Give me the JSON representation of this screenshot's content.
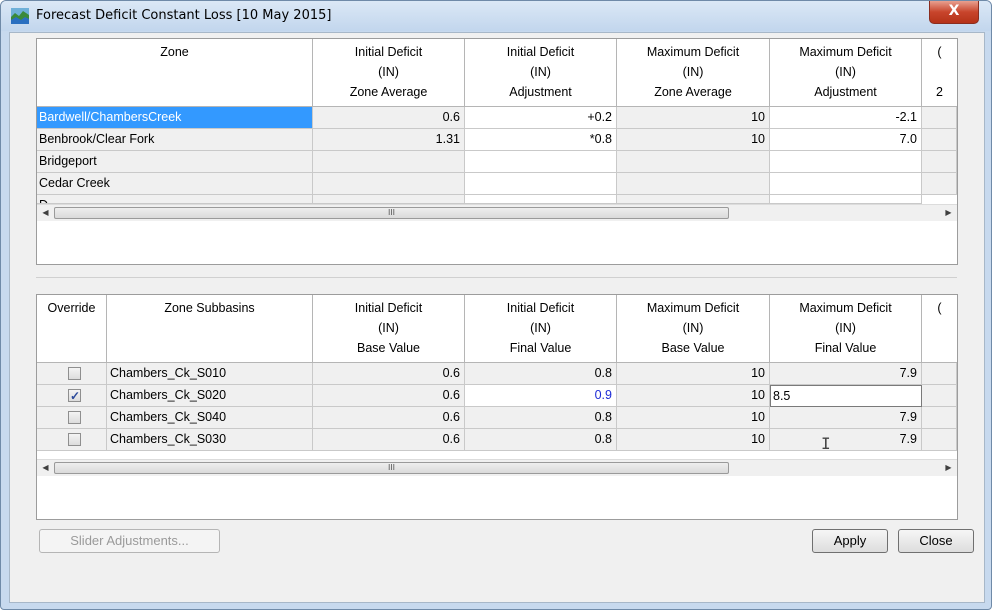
{
  "window": {
    "title": "Forecast Deficit Constant Loss [10 May 2015]",
    "close_label": "X"
  },
  "zone_table": {
    "headers": [
      {
        "lines": [
          "Zone",
          "",
          ""
        ]
      },
      {
        "lines": [
          "Initial Deficit",
          "(IN)",
          "Zone Average"
        ]
      },
      {
        "lines": [
          "Initial Deficit",
          "(IN)",
          "Adjustment"
        ]
      },
      {
        "lines": [
          "Maximum Deficit",
          "(IN)",
          "Zone Average"
        ]
      },
      {
        "lines": [
          "Maximum Deficit",
          "(IN)",
          "Adjustment"
        ]
      },
      {
        "lines": [
          "(",
          "",
          "2"
        ]
      }
    ],
    "rows": [
      {
        "zone": "Bardwell/ChambersCreek",
        "init_avg": "0.6",
        "init_adj": "+0.2",
        "max_avg": "10",
        "max_adj": "-2.1"
      },
      {
        "zone": "Benbrook/Clear Fork",
        "init_avg": "1.31",
        "init_adj": "*0.8",
        "max_avg": "10",
        "max_adj": "7.0"
      },
      {
        "zone": "Bridgeport",
        "init_avg": "",
        "init_adj": "",
        "max_avg": "",
        "max_adj": ""
      },
      {
        "zone": "Cedar Creek",
        "init_avg": "",
        "init_adj": "",
        "max_avg": "",
        "max_adj": ""
      },
      {
        "zone": "D...",
        "init_avg": "",
        "init_adj": "",
        "max_avg": "",
        "max_adj": ""
      }
    ]
  },
  "subbasin_table": {
    "headers": [
      {
        "lines": [
          "Override",
          "",
          ""
        ]
      },
      {
        "lines": [
          "Zone Subbasins",
          "",
          ""
        ]
      },
      {
        "lines": [
          "Initial Deficit",
          "(IN)",
          "Base Value"
        ]
      },
      {
        "lines": [
          "Initial Deficit",
          "(IN)",
          "Final Value"
        ]
      },
      {
        "lines": [
          "Maximum Deficit",
          "(IN)",
          "Base Value"
        ]
      },
      {
        "lines": [
          "Maximum Deficit",
          "(IN)",
          "Final Value"
        ]
      },
      {
        "lines": [
          "(",
          "",
          ""
        ]
      }
    ],
    "rows": [
      {
        "override": false,
        "name": "Chambers_Ck_S010",
        "init_base": "0.6",
        "init_final": "0.8",
        "max_base": "10",
        "max_final": "7.9"
      },
      {
        "override": true,
        "name": "Chambers_Ck_S020",
        "init_base": "0.6",
        "init_final": "0.9",
        "max_base": "10",
        "max_final": "8.5"
      },
      {
        "override": false,
        "name": "Chambers_Ck_S040",
        "init_base": "0.6",
        "init_final": "0.8",
        "max_base": "10",
        "max_final": "7.9"
      },
      {
        "override": false,
        "name": "Chambers_Ck_S030",
        "init_base": "0.6",
        "init_final": "0.8",
        "max_base": "10",
        "max_final": "7.9"
      }
    ]
  },
  "scroll": {
    "grip": "III"
  },
  "footer": {
    "slider_label": "Slider Adjustments...",
    "apply_label": "Apply",
    "close_label": "Close"
  }
}
